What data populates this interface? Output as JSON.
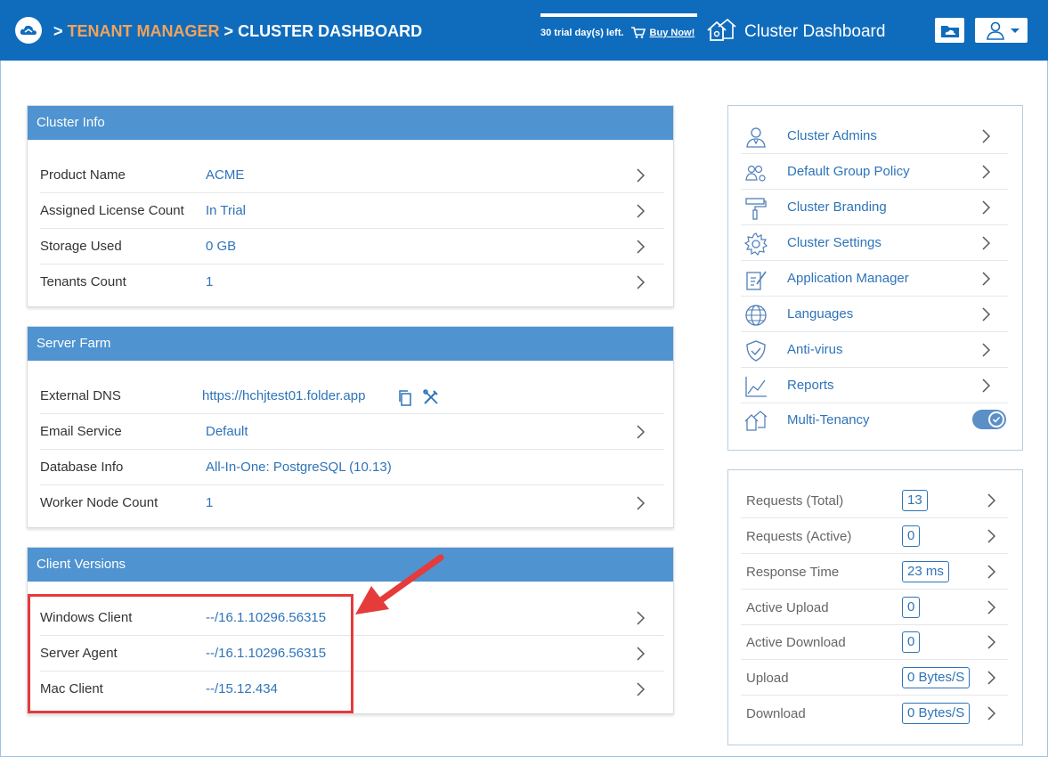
{
  "header": {
    "breadcrumb_sep1": ">",
    "breadcrumb_tenant": "TENANT MANAGER",
    "breadcrumb_sep2": ">",
    "breadcrumb_current": "CLUSTER DASHBOARD",
    "trial_text": "30 trial day(s) left.",
    "buy_now": "Buy Now!",
    "title": "Cluster Dashboard",
    "colors": {
      "bar": "#0f6cbd",
      "accent": "#f2a35a"
    }
  },
  "cluster_info": {
    "title": "Cluster Info",
    "rows": [
      {
        "label": "Product Name",
        "value": "ACME"
      },
      {
        "label": "Assigned License Count",
        "value": "In Trial"
      },
      {
        "label": "Storage Used",
        "value": "0 GB"
      },
      {
        "label": "Tenants Count",
        "value": "1"
      }
    ]
  },
  "server_farm": {
    "title": "Server Farm",
    "rows": [
      {
        "label": "External DNS",
        "value": "https://hchjtest01.folder.app"
      },
      {
        "label": "Email Service",
        "value": "Default"
      },
      {
        "label": "Database Info",
        "value": "All-In-One: PostgreSQL (10.13)"
      },
      {
        "label": "Worker Node Count",
        "value": "1"
      }
    ]
  },
  "client_versions": {
    "title": "Client Versions",
    "rows": [
      {
        "label": "Windows Client",
        "value": "--/16.1.10296.56315"
      },
      {
        "label": "Server Agent",
        "value": "--/16.1.10296.56315"
      },
      {
        "label": "Mac Client",
        "value": "--/15.12.434"
      }
    ]
  },
  "menu": {
    "items": [
      {
        "label": "Cluster Admins",
        "icon": "admin-icon"
      },
      {
        "label": "Default Group Policy",
        "icon": "group-policy-icon"
      },
      {
        "label": "Cluster Branding",
        "icon": "paint-roller-icon"
      },
      {
        "label": "Cluster Settings",
        "icon": "gear-icon"
      },
      {
        "label": "Application Manager",
        "icon": "app-manager-icon"
      },
      {
        "label": "Languages",
        "icon": "globe-icon"
      },
      {
        "label": "Anti-virus",
        "icon": "shield-icon"
      },
      {
        "label": "Reports",
        "icon": "chart-icon"
      },
      {
        "label": "Multi-Tenancy",
        "icon": "multi-tenancy-icon"
      }
    ]
  },
  "stats": {
    "items": [
      {
        "label": "Requests (Total)",
        "value": "13"
      },
      {
        "label": "Requests (Active)",
        "value": "0"
      },
      {
        "label": "Response Time",
        "value": "23 ms"
      },
      {
        "label": "Active Upload",
        "value": "0"
      },
      {
        "label": "Active Download",
        "value": "0"
      },
      {
        "label": "Upload",
        "value": "0 Bytes/S"
      },
      {
        "label": "Download",
        "value": "0 Bytes/S"
      }
    ]
  }
}
